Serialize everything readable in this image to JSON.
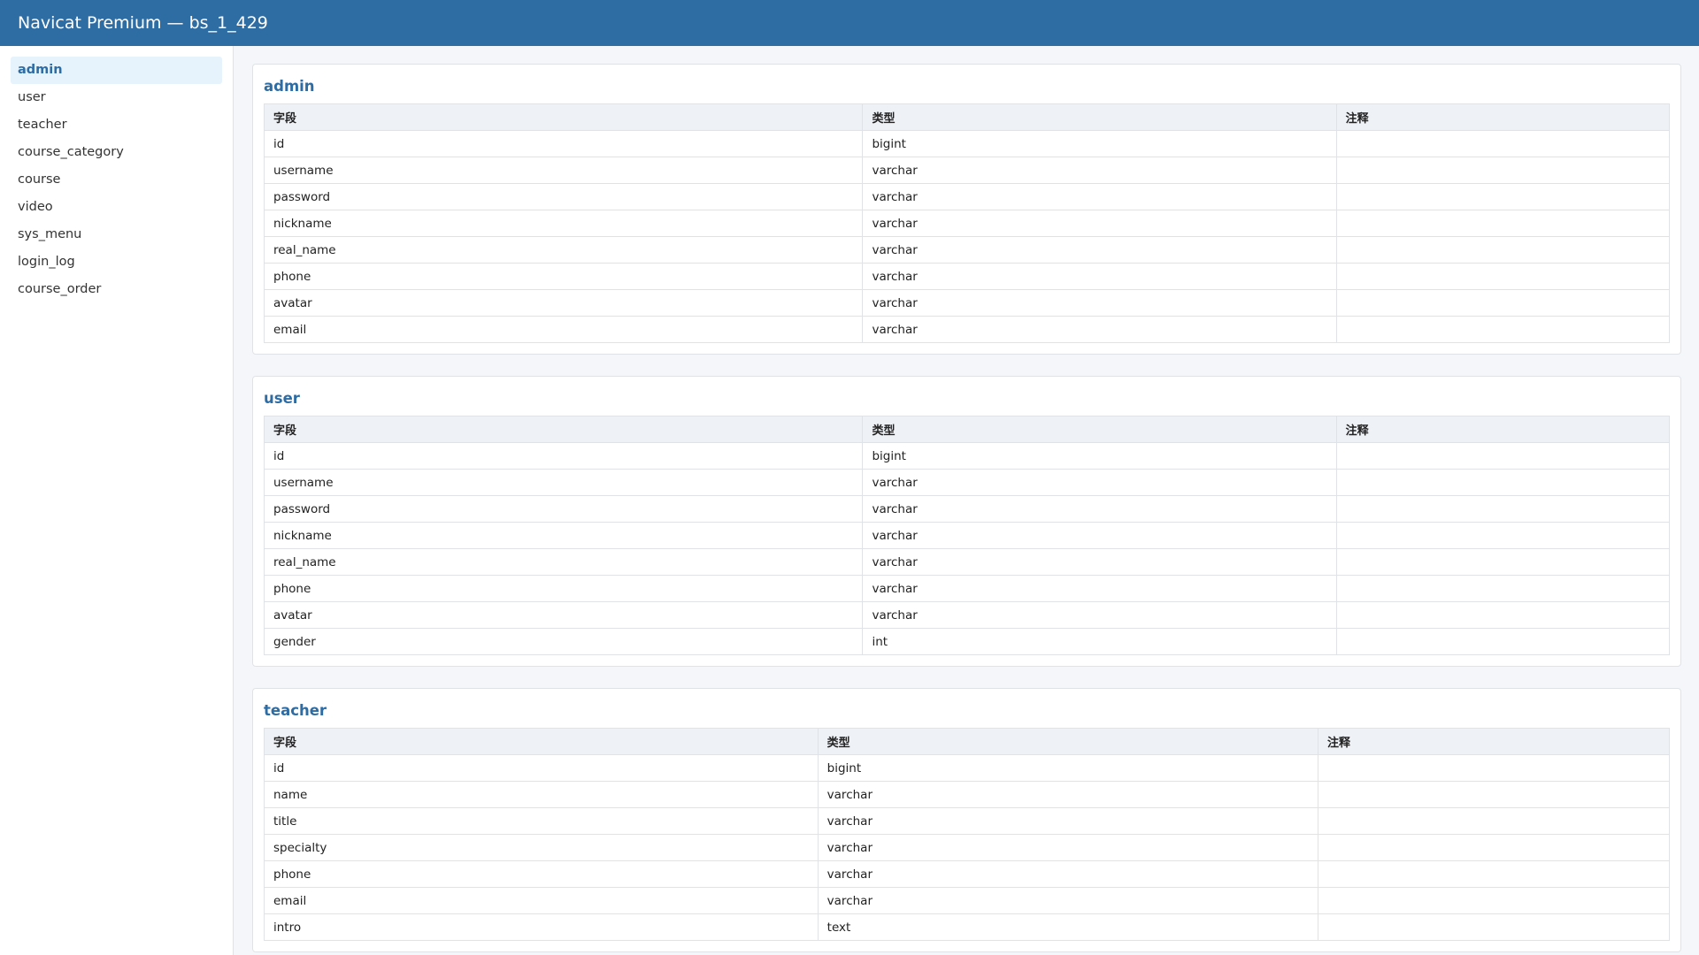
{
  "window": {
    "title": "Navicat Premium — bs_1_429"
  },
  "colors": {
    "titlebar": "#2e6ca4",
    "accent": "#2e6ca4",
    "active_bg": "#e6f2fc"
  },
  "sidebar": {
    "active": "admin",
    "items": [
      {
        "label": "admin"
      },
      {
        "label": "user"
      },
      {
        "label": "teacher"
      },
      {
        "label": "course_category"
      },
      {
        "label": "course"
      },
      {
        "label": "video"
      },
      {
        "label": "sys_menu"
      },
      {
        "label": "login_log"
      },
      {
        "label": "course_order"
      }
    ]
  },
  "main": {
    "tables": [
      {
        "name": "admin",
        "columns": [
          "字段",
          "类型",
          "注释"
        ],
        "rows": [
          [
            "id",
            "bigint",
            ""
          ],
          [
            "username",
            "varchar",
            ""
          ],
          [
            "password",
            "varchar",
            ""
          ],
          [
            "nickname",
            "varchar",
            ""
          ],
          [
            "real_name",
            "varchar",
            ""
          ],
          [
            "phone",
            "varchar",
            ""
          ],
          [
            "avatar",
            "varchar",
            ""
          ],
          [
            "email",
            "varchar",
            ""
          ]
        ]
      },
      {
        "name": "user",
        "columns": [
          "字段",
          "类型",
          "注释"
        ],
        "rows": [
          [
            "id",
            "bigint",
            ""
          ],
          [
            "username",
            "varchar",
            ""
          ],
          [
            "password",
            "varchar",
            ""
          ],
          [
            "nickname",
            "varchar",
            ""
          ],
          [
            "real_name",
            "varchar",
            ""
          ],
          [
            "phone",
            "varchar",
            ""
          ],
          [
            "avatar",
            "varchar",
            ""
          ],
          [
            "gender",
            "int",
            ""
          ]
        ]
      },
      {
        "name": "teacher",
        "columns": [
          "字段",
          "类型",
          "注释"
        ],
        "rows": [
          [
            "id",
            "bigint",
            ""
          ],
          [
            "name",
            "varchar",
            ""
          ],
          [
            "title",
            "varchar",
            ""
          ],
          [
            "specialty",
            "varchar",
            ""
          ],
          [
            "phone",
            "varchar",
            ""
          ],
          [
            "email",
            "varchar",
            ""
          ],
          [
            "intro",
            "text",
            ""
          ]
        ]
      }
    ]
  }
}
